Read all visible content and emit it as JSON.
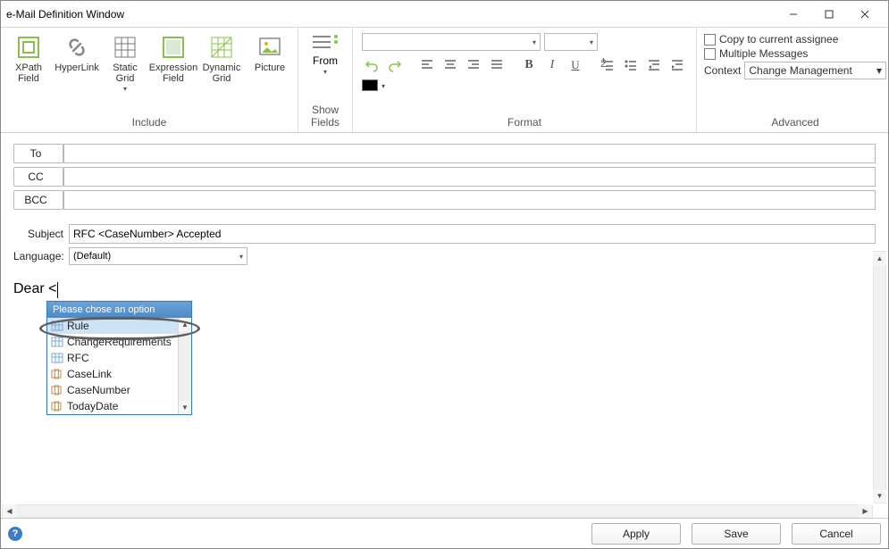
{
  "window": {
    "title": "e-Mail Definition Window"
  },
  "ribbon": {
    "include_label": "Include",
    "showfields_label": "Show Fields",
    "format_label": "Format",
    "advanced_label": "Advanced",
    "buttons": {
      "xpath": "XPath Field",
      "hyperlink": "HyperLink",
      "static_grid": "Static Grid",
      "expr_field": "Expression Field",
      "dyn_grid": "Dynamic Grid",
      "picture": "Picture",
      "from": "From"
    },
    "font_value": "",
    "size_value": ""
  },
  "advanced": {
    "copy_assignee": "Copy to current assignee",
    "multiple_msgs": "Multiple Messages",
    "context_label": "Context",
    "context_value": "Change Management"
  },
  "fields": {
    "to": "To",
    "cc": "CC",
    "bcc": "BCC",
    "subject_label": "Subject",
    "subject_value": "RFC <CaseNumber> Accepted",
    "language_label": "Language:",
    "language_value": "(Default)"
  },
  "body": {
    "text": "Dear <"
  },
  "popup": {
    "header": "Please chose an option",
    "items": [
      {
        "label": "Rule",
        "selected": true,
        "kind": "grid"
      },
      {
        "label": "ChangeRequirements",
        "selected": false,
        "kind": "grid"
      },
      {
        "label": "RFC",
        "selected": false,
        "kind": "grid"
      },
      {
        "label": "CaseLink",
        "selected": false,
        "kind": "tag"
      },
      {
        "label": "CaseNumber",
        "selected": false,
        "kind": "tag"
      },
      {
        "label": "TodayDate",
        "selected": false,
        "kind": "tag"
      }
    ]
  },
  "footer": {
    "apply": "Apply",
    "save": "Save",
    "cancel": "Cancel"
  }
}
